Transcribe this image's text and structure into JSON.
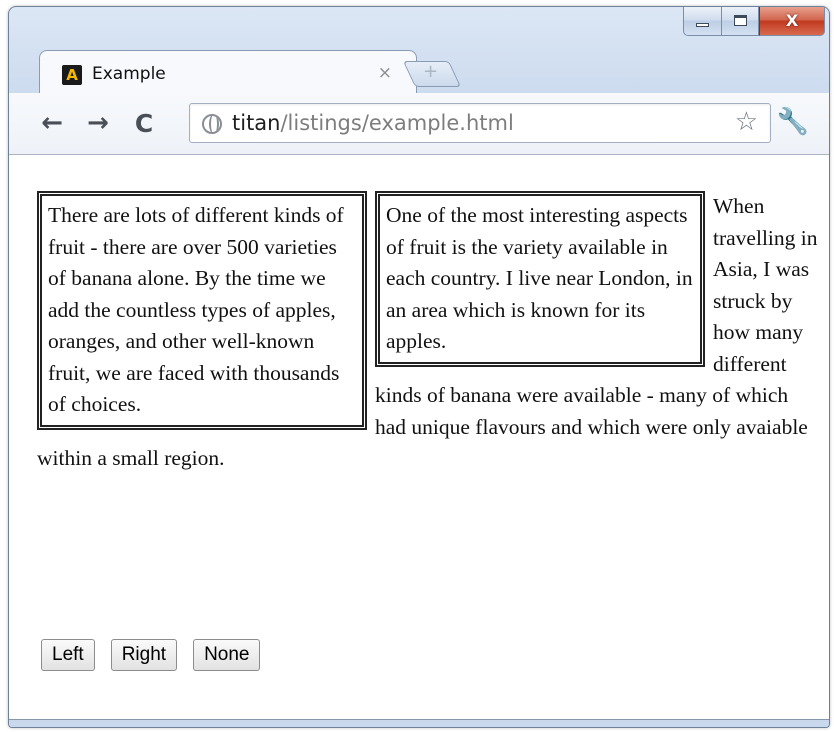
{
  "window": {
    "tab_title": "Example",
    "tab_close_glyph": "×",
    "new_tab_glyph": "+",
    "minimize_glyph": "",
    "close_glyph": "X"
  },
  "toolbar": {
    "back_glyph": "←",
    "forward_glyph": "→",
    "reload_glyph": "C",
    "url_host": "titan",
    "url_path": "/listings/example.html",
    "star_glyph": "☆",
    "wrench_glyph": "🔧"
  },
  "content": {
    "box_one": "There are lots of different kinds of fruit - there are over 500 varieties of banana alone. By the time we add the countless types of apples, oranges, and other well-known fruit, we are faced with thousands of choices.",
    "box_two": "One of the most interesting aspects of fruit is the variety available in each country. I live near London, in an area which is known for its apples.",
    "paragraph": "When travelling in Asia, I was struck by how many different kinds of banana were available - many of which had unique flavours and which were only avaiable within a small region."
  },
  "buttons": {
    "left": "Left",
    "right": "Right",
    "none": "None"
  },
  "colors": {
    "frame": "#cbdaee",
    "close_button": "#c0391f",
    "favicon_bg": "#1a1a1a",
    "favicon_fg": "#f5b800"
  },
  "icons": {
    "favicon": "A"
  }
}
